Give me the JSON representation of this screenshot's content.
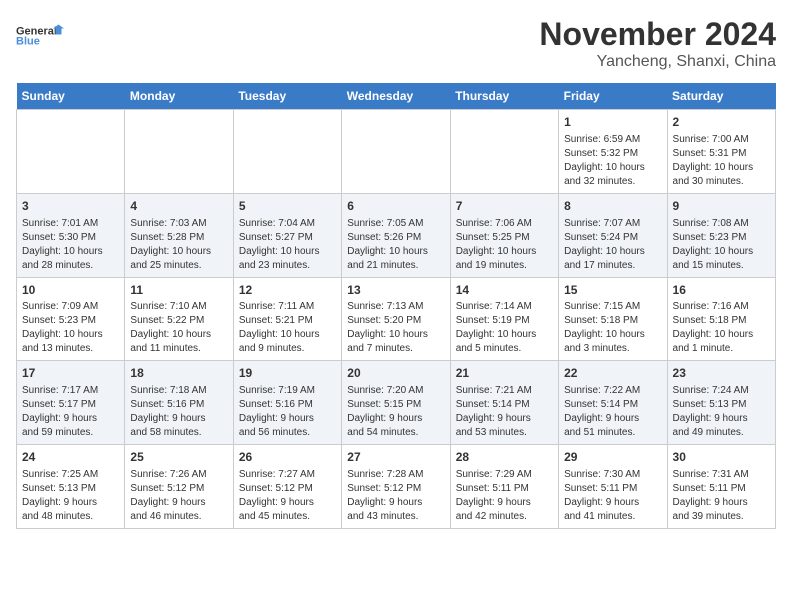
{
  "logo": {
    "line1": "General",
    "line2": "Blue"
  },
  "title": "November 2024",
  "location": "Yancheng, Shanxi, China",
  "weekdays": [
    "Sunday",
    "Monday",
    "Tuesday",
    "Wednesday",
    "Thursday",
    "Friday",
    "Saturday"
  ],
  "weeks": [
    [
      {
        "day": "",
        "info": ""
      },
      {
        "day": "",
        "info": ""
      },
      {
        "day": "",
        "info": ""
      },
      {
        "day": "",
        "info": ""
      },
      {
        "day": "",
        "info": ""
      },
      {
        "day": "1",
        "info": "Sunrise: 6:59 AM\nSunset: 5:32 PM\nDaylight: 10 hours\nand 32 minutes."
      },
      {
        "day": "2",
        "info": "Sunrise: 7:00 AM\nSunset: 5:31 PM\nDaylight: 10 hours\nand 30 minutes."
      }
    ],
    [
      {
        "day": "3",
        "info": "Sunrise: 7:01 AM\nSunset: 5:30 PM\nDaylight: 10 hours\nand 28 minutes."
      },
      {
        "day": "4",
        "info": "Sunrise: 7:03 AM\nSunset: 5:28 PM\nDaylight: 10 hours\nand 25 minutes."
      },
      {
        "day": "5",
        "info": "Sunrise: 7:04 AM\nSunset: 5:27 PM\nDaylight: 10 hours\nand 23 minutes."
      },
      {
        "day": "6",
        "info": "Sunrise: 7:05 AM\nSunset: 5:26 PM\nDaylight: 10 hours\nand 21 minutes."
      },
      {
        "day": "7",
        "info": "Sunrise: 7:06 AM\nSunset: 5:25 PM\nDaylight: 10 hours\nand 19 minutes."
      },
      {
        "day": "8",
        "info": "Sunrise: 7:07 AM\nSunset: 5:24 PM\nDaylight: 10 hours\nand 17 minutes."
      },
      {
        "day": "9",
        "info": "Sunrise: 7:08 AM\nSunset: 5:23 PM\nDaylight: 10 hours\nand 15 minutes."
      }
    ],
    [
      {
        "day": "10",
        "info": "Sunrise: 7:09 AM\nSunset: 5:23 PM\nDaylight: 10 hours\nand 13 minutes."
      },
      {
        "day": "11",
        "info": "Sunrise: 7:10 AM\nSunset: 5:22 PM\nDaylight: 10 hours\nand 11 minutes."
      },
      {
        "day": "12",
        "info": "Sunrise: 7:11 AM\nSunset: 5:21 PM\nDaylight: 10 hours\nand 9 minutes."
      },
      {
        "day": "13",
        "info": "Sunrise: 7:13 AM\nSunset: 5:20 PM\nDaylight: 10 hours\nand 7 minutes."
      },
      {
        "day": "14",
        "info": "Sunrise: 7:14 AM\nSunset: 5:19 PM\nDaylight: 10 hours\nand 5 minutes."
      },
      {
        "day": "15",
        "info": "Sunrise: 7:15 AM\nSunset: 5:18 PM\nDaylight: 10 hours\nand 3 minutes."
      },
      {
        "day": "16",
        "info": "Sunrise: 7:16 AM\nSunset: 5:18 PM\nDaylight: 10 hours\nand 1 minute."
      }
    ],
    [
      {
        "day": "17",
        "info": "Sunrise: 7:17 AM\nSunset: 5:17 PM\nDaylight: 9 hours\nand 59 minutes."
      },
      {
        "day": "18",
        "info": "Sunrise: 7:18 AM\nSunset: 5:16 PM\nDaylight: 9 hours\nand 58 minutes."
      },
      {
        "day": "19",
        "info": "Sunrise: 7:19 AM\nSunset: 5:16 PM\nDaylight: 9 hours\nand 56 minutes."
      },
      {
        "day": "20",
        "info": "Sunrise: 7:20 AM\nSunset: 5:15 PM\nDaylight: 9 hours\nand 54 minutes."
      },
      {
        "day": "21",
        "info": "Sunrise: 7:21 AM\nSunset: 5:14 PM\nDaylight: 9 hours\nand 53 minutes."
      },
      {
        "day": "22",
        "info": "Sunrise: 7:22 AM\nSunset: 5:14 PM\nDaylight: 9 hours\nand 51 minutes."
      },
      {
        "day": "23",
        "info": "Sunrise: 7:24 AM\nSunset: 5:13 PM\nDaylight: 9 hours\nand 49 minutes."
      }
    ],
    [
      {
        "day": "24",
        "info": "Sunrise: 7:25 AM\nSunset: 5:13 PM\nDaylight: 9 hours\nand 48 minutes."
      },
      {
        "day": "25",
        "info": "Sunrise: 7:26 AM\nSunset: 5:12 PM\nDaylight: 9 hours\nand 46 minutes."
      },
      {
        "day": "26",
        "info": "Sunrise: 7:27 AM\nSunset: 5:12 PM\nDaylight: 9 hours\nand 45 minutes."
      },
      {
        "day": "27",
        "info": "Sunrise: 7:28 AM\nSunset: 5:12 PM\nDaylight: 9 hours\nand 43 minutes."
      },
      {
        "day": "28",
        "info": "Sunrise: 7:29 AM\nSunset: 5:11 PM\nDaylight: 9 hours\nand 42 minutes."
      },
      {
        "day": "29",
        "info": "Sunrise: 7:30 AM\nSunset: 5:11 PM\nDaylight: 9 hours\nand 41 minutes."
      },
      {
        "day": "30",
        "info": "Sunrise: 7:31 AM\nSunset: 5:11 PM\nDaylight: 9 hours\nand 39 minutes."
      }
    ]
  ]
}
